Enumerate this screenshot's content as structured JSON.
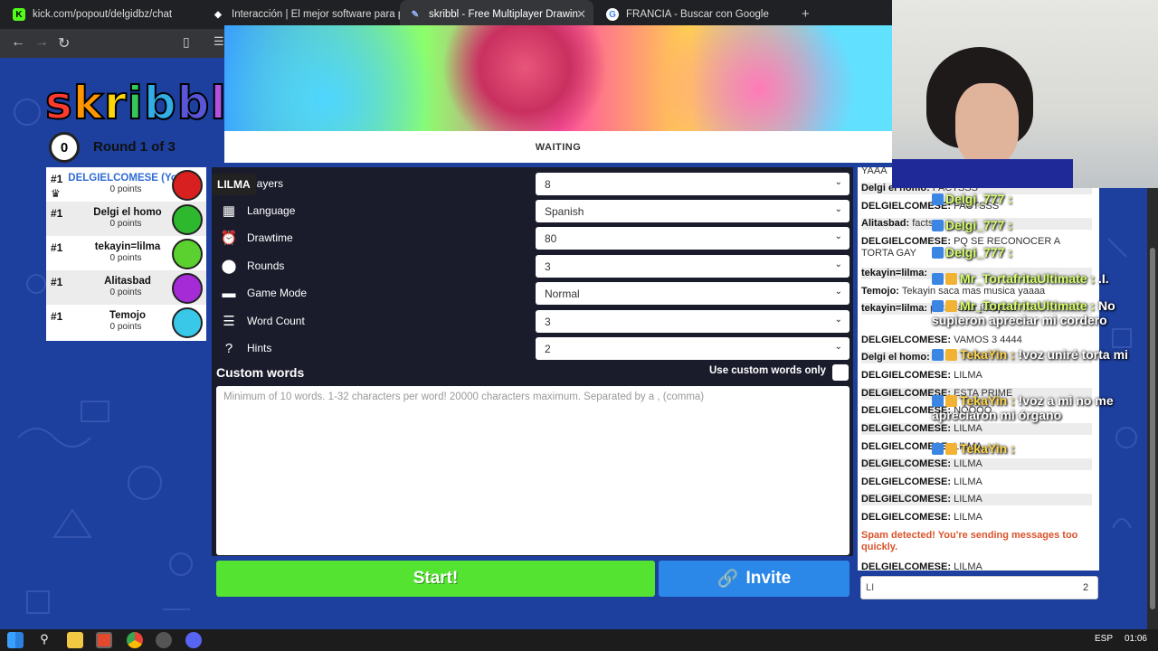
{
  "browser": {
    "tabs": [
      {
        "label": "kick.com/popout/delgidbz/chat",
        "active": false
      },
      {
        "label": "Interacción | El mejor software para p",
        "active": false
      },
      {
        "label": "skribbl - Free Multiplayer Drawin",
        "active": true
      },
      {
        "label": "FRANCIA - Buscar con Google",
        "active": false
      }
    ],
    "new_tab": "+"
  },
  "game": {
    "logo": "skribbl",
    "round_counter": "0",
    "round_label": "Round 1 of 3",
    "status": "WAITING",
    "tooltip": "LILMA",
    "players": [
      {
        "rank": "#1",
        "name": "DELGIELCOMESE (You)",
        "points": "0 points",
        "color": "#d82020",
        "crown": true
      },
      {
        "rank": "#1",
        "name": "Delgi el homo",
        "points": "0 points",
        "color": "#2db82d",
        "crown": false
      },
      {
        "rank": "#1",
        "name": "tekayin=lilma",
        "points": "0 points",
        "color": "#5bd12f",
        "crown": false
      },
      {
        "rank": "#1",
        "name": "Alitasbad",
        "points": "0 points",
        "color": "#a42bd6",
        "crown": false
      },
      {
        "rank": "#1",
        "name": "Temojo",
        "points": "0 points",
        "color": "#39c8e8",
        "crown": false
      }
    ],
    "settings": [
      {
        "label": "Players",
        "value": "8",
        "icon": "players-icon"
      },
      {
        "label": "Language",
        "value": "Spanish",
        "icon": "language-icon"
      },
      {
        "label": "Drawtime",
        "value": "80",
        "icon": "drawtime-icon"
      },
      {
        "label": "Rounds",
        "value": "3",
        "icon": "rounds-icon"
      },
      {
        "label": "Game Mode",
        "value": "Normal",
        "icon": "game-mode-icon"
      },
      {
        "label": "Word Count",
        "value": "3",
        "icon": "word-count-icon"
      },
      {
        "label": "Hints",
        "value": "2",
        "icon": "hints-icon"
      }
    ],
    "custom_words_title": "Custom words",
    "custom_words_toggle_label": "Use custom words only",
    "custom_words_placeholder": "Minimum of 10 words. 1-32 characters per word! 20000 characters maximum. Separated by a , (comma)",
    "start_label": "Start!",
    "invite_label": "Invite"
  },
  "chat": {
    "lines": [
      {
        "user": "",
        "text": "YAAA"
      },
      {
        "user": "Delgi el homo:",
        "text": "FACTSSS"
      },
      {
        "user": "DELGIELCOMESE:",
        "text": "FACTSSS"
      },
      {
        "user": "Alitasbad:",
        "text": "facts"
      },
      {
        "user": "DELGIELCOMESE:",
        "text": "PQ SE RECONOCER A TORTA GAY"
      },
      {
        "user": "tekayin=lilma:",
        "text": ""
      },
      {
        "user": "Temojo:",
        "text": "Tekayin saca mas musica yaaaa"
      },
      {
        "user": "tekayin=lilma:",
        "text": "para sacar jasdjasd"
      },
      {
        "user": "DELGIELCOMESE:",
        "text": "VAMOS 3 4444"
      },
      {
        "user": "Delgi el homo:",
        "text": ""
      },
      {
        "user": "DELGIELCOMESE:",
        "text": "LILMA"
      },
      {
        "user": "DELGIELCOMESE:",
        "text": "ESTA PRIME"
      },
      {
        "user": "DELGIELCOMESE:",
        "text": "NOOOO"
      },
      {
        "user": "DELGIELCOMESE:",
        "text": "LILMA"
      },
      {
        "user": "DELGIELCOMESE:",
        "text": "LILMA"
      },
      {
        "user": "DELGIELCOMESE:",
        "text": "LILMA"
      },
      {
        "user": "DELGIELCOMESE:",
        "text": "LILMA"
      },
      {
        "user": "DELGIELCOMESE:",
        "text": "LILMA"
      },
      {
        "user": "DELGIELCOMESE:",
        "text": "LILMA"
      }
    ],
    "spam_notice": "Spam detected! You're sending messages too quickly.",
    "last_line": {
      "user": "DELGIELCOMESE:",
      "text": "LILMA"
    },
    "input_value": "LI",
    "char_count": "2"
  },
  "overlay": [
    {
      "user": "Delgi_777 :",
      "text": ""
    },
    {
      "user": "Delgi_777 :",
      "text": ""
    },
    {
      "user": "Delgi_777 :",
      "text": ""
    },
    {
      "user": "Mr_TortafritaUltimate :",
      "text": ".I."
    },
    {
      "user": "Mr_TortafritaUltimate :",
      "text": "No supieron apreciar mi cordero"
    },
    {
      "user": "TekaYin :",
      "text": "!voz uniré torta mi"
    },
    {
      "user": "TekaYin :",
      "text": "!voz a mi no me apreciaron mi órgano"
    },
    {
      "user": "TekaYin :",
      "text": ""
    }
  ],
  "taskbar": {
    "lang": "ESP",
    "time": "01:06"
  }
}
